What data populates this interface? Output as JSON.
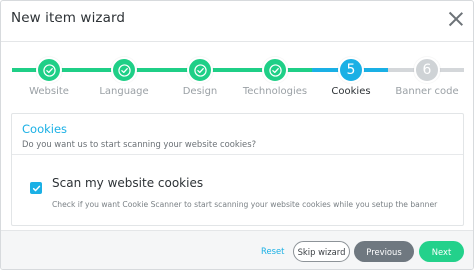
{
  "dialog": {
    "title": "New item wizard"
  },
  "steps": [
    {
      "label": "Website",
      "status": "done"
    },
    {
      "label": "Language",
      "status": "done"
    },
    {
      "label": "Design",
      "status": "done"
    },
    {
      "label": "Technologies",
      "status": "done"
    },
    {
      "label": "Cookies",
      "status": "active",
      "number": "5"
    },
    {
      "label": "Banner code",
      "status": "todo",
      "number": "6"
    }
  ],
  "section": {
    "title": "Cookies",
    "description": "Do you want us to start scanning your website cookies?",
    "option": {
      "label": "Scan my website cookies",
      "checked": true,
      "help": "Check if you want Cookie Scanner to start scanning your website cookies while you setup the banner"
    }
  },
  "footer": {
    "reset_label": "Reset",
    "skip_label": "Skip wizard",
    "previous_label": "Previous",
    "next_label": "Next"
  },
  "colors": {
    "done": "#1fcf87",
    "active": "#1ab0e5",
    "todo": "#cfd3d6",
    "next_button": "#23d18b",
    "previous_button": "#6f7880"
  },
  "icons": {
    "close": "close-icon",
    "step_done": "check-icon",
    "checkbox": "checkmark-icon"
  }
}
